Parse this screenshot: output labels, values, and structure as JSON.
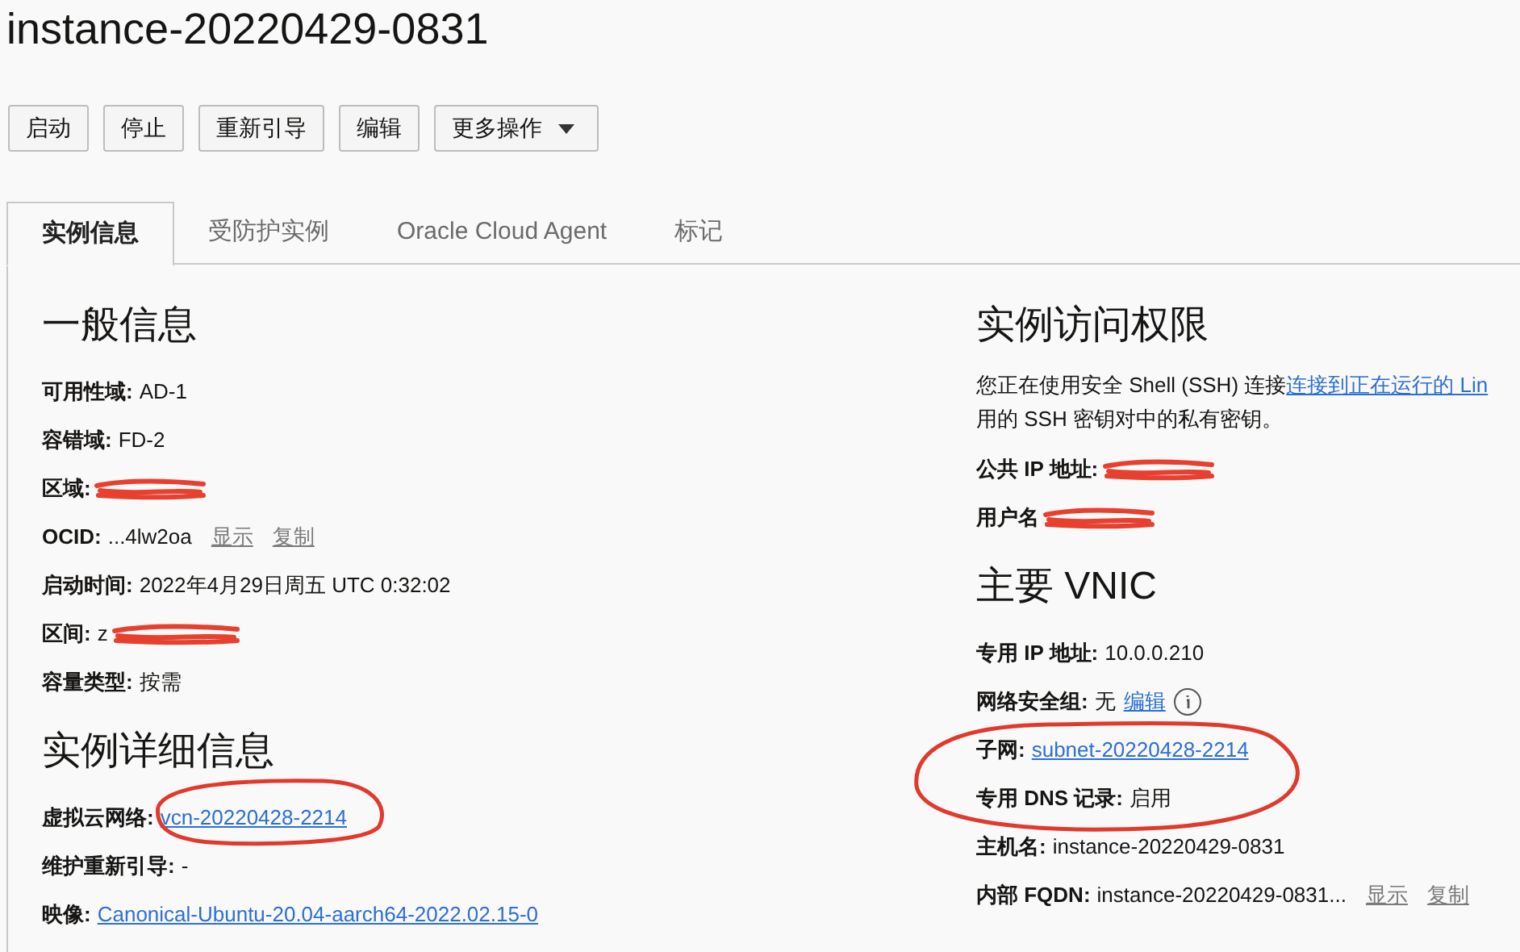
{
  "title": "instance-20220429-0831",
  "buttons": [
    {
      "label": "启动"
    },
    {
      "label": "停止"
    },
    {
      "label": "重新引导"
    },
    {
      "label": "编辑"
    },
    {
      "label": "更多操作",
      "kind": "dropdown"
    }
  ],
  "tabs": [
    {
      "label": "实例信息",
      "selected": true
    },
    {
      "label": "受防护实例",
      "selected": false
    },
    {
      "label": "Oracle Cloud Agent",
      "selected": false
    },
    {
      "label": "标记",
      "selected": false
    }
  ],
  "left": [
    {
      "heading": "一般信息",
      "rows": [
        {
          "label": "可用性域:",
          "value": "AD-1",
          "kind": "text"
        },
        {
          "label": "容错域:",
          "value": "FD-2",
          "kind": "text"
        },
        {
          "label": "区域:",
          "kind": "redacted"
        },
        {
          "label": "OCID:",
          "value": "...4lw2oa",
          "kind": "text",
          "actions": [
            "显示",
            "复制"
          ]
        },
        {
          "label": "启动时间:",
          "value": "2022年4月29日周五 UTC 0:32:02",
          "kind": "text"
        },
        {
          "label": "区间:",
          "value": "z",
          "kind": "redacted"
        },
        {
          "label": "容量类型:",
          "value": "按需",
          "kind": "text"
        }
      ]
    },
    {
      "heading": "实例详细信息",
      "rows": [
        {
          "label": "虚拟云网络:",
          "value": "vcn-20220428-2214",
          "kind": "link"
        },
        {
          "label": "维护重新引导:",
          "value": "-",
          "kind": "text"
        },
        {
          "label": "映像:",
          "value": "Canonical-Ubuntu-20.04-aarch64-2022.02.15-0",
          "kind": "link"
        }
      ]
    }
  ],
  "right": [
    {
      "heading": "实例访问权限",
      "paragraph": {
        "before": "您正在使用安全 Shell (SSH) 连接",
        "link": "连接到正在运行的 Lin",
        "after": "用的 SSH 密钥对中的私有密钥。"
      },
      "rows": [
        {
          "label": "公共 IP 地址:",
          "kind": "redacted"
        },
        {
          "label": "用户名",
          "kind": "redacted"
        }
      ]
    },
    {
      "heading": "主要 VNIC",
      "rows": [
        {
          "label": "专用 IP 地址:",
          "value": "10.0.0.210",
          "kind": "text"
        },
        {
          "label": "网络安全组:",
          "value": "无",
          "kind": "text",
          "link": "编辑",
          "info": true
        },
        {
          "label": "子网:",
          "value": "subnet-20220428-2214",
          "kind": "link"
        },
        {
          "label": "专用 DNS 记录:",
          "value": "启用",
          "kind": "text"
        },
        {
          "label": "主机名:",
          "value": "instance-20220429-0831",
          "kind": "text"
        },
        {
          "label": "内部 FQDN:",
          "value": "instance-20220429-0831...",
          "kind": "text",
          "actions": [
            "显示",
            "复制"
          ]
        }
      ]
    }
  ]
}
